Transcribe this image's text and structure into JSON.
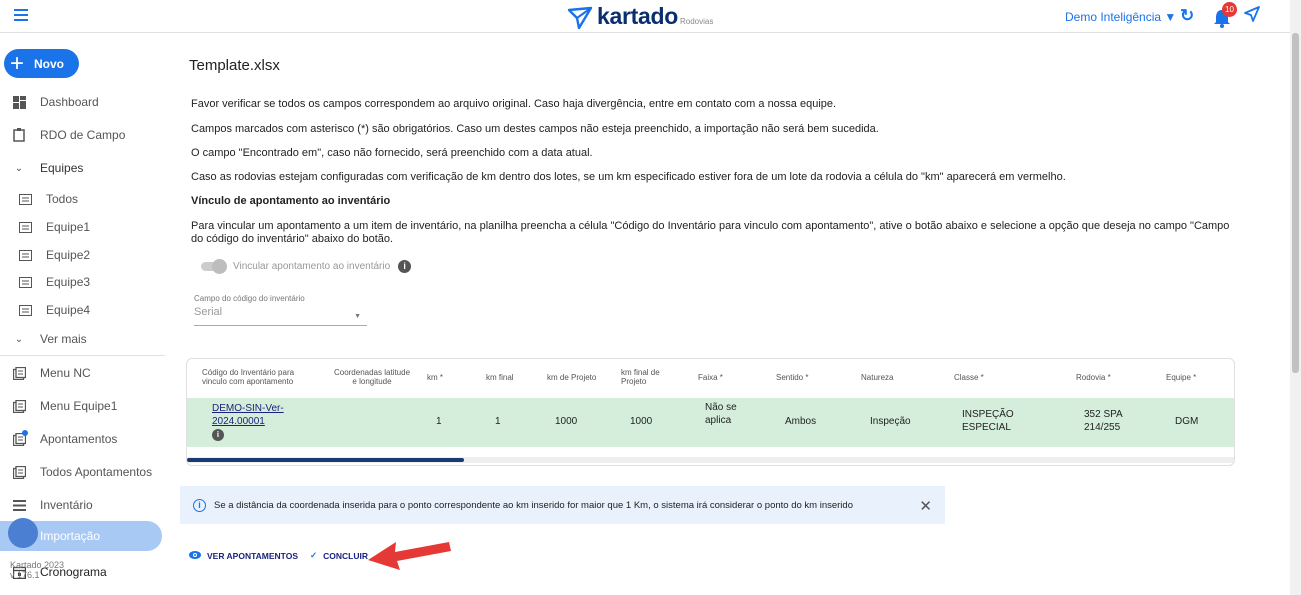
{
  "header": {
    "brand": "kartado",
    "brand_sub": "Rodovias",
    "org_selector": "Demo Inteligência ▼",
    "notifications_count": "10"
  },
  "sidebar": {
    "new_button": "Novo",
    "items": [
      {
        "label": "Dashboard",
        "icon": "dashboard-icon"
      },
      {
        "label": "RDO de Campo",
        "icon": "clipboard-icon"
      },
      {
        "label": "Equipes",
        "icon": "chevron-down-icon"
      },
      {
        "label": "Todos",
        "icon": "list-icon"
      },
      {
        "label": "Equipe1",
        "icon": "list-icon"
      },
      {
        "label": "Equipe2",
        "icon": "list-icon"
      },
      {
        "label": "Equipe3",
        "icon": "list-icon"
      },
      {
        "label": "Equipe4",
        "icon": "list-icon"
      },
      {
        "label": "Ver mais",
        "icon": "chevron-down-icon"
      },
      {
        "label": "Menu NC",
        "icon": "report-icon"
      },
      {
        "label": "Menu Equipe1",
        "icon": "report-icon"
      },
      {
        "label": "Apontamentos",
        "icon": "report-icon"
      },
      {
        "label": "Todos Apontamentos",
        "icon": "report-icon"
      },
      {
        "label": "Inventário",
        "icon": "list-icon"
      },
      {
        "label": "Importação",
        "icon": "import-icon"
      },
      {
        "label": "Cronograma",
        "icon": "calendar-icon"
      }
    ],
    "footer_line1": "Kartado 2023",
    "footer_line2": "v 176.1"
  },
  "main": {
    "title": "Template.xlsx",
    "paragraphs": [
      "Favor verificar se todos os campos correspondem ao arquivo original. Caso haja divergência, entre em contato com a nossa equipe.",
      "Campos marcados com asterisco (*) são obrigatórios. Caso um destes campos não esteja preenchido, a importação não será bem sucedida.",
      "O campo \"Encontrado em\", caso não fornecido, será preenchido com a data atual.",
      "Caso as rodovias estejam configuradas com verificação de km dentro dos lotes, se um km especificado estiver fora de um lote da rodovia a célula do \"km\" aparecerá em vermelho."
    ],
    "section_title": "Vínculo de apontamento ao inventário",
    "section_text": "Para vincular um apontamento a um item de inventário, na planilha preencha a célula \"Código do Inventário para vinculo com apontamento\", ative o botão abaixo e selecione a opção que deseja no campo \"Campo do código do inventário\" abaixo do botão.",
    "toggle_label": "Vincular apontamento ao inventário",
    "select_label": "Campo do código do inventário",
    "select_value": "Serial"
  },
  "table": {
    "headers": {
      "code": "Código do Inventário para vinculo com apontamento",
      "coords": "Coordenadas latitude e longitude",
      "km": "km *",
      "km_final": "km final",
      "km_proj": "km de Projeto",
      "km_final_proj": "km final de Projeto",
      "faixa": "Faixa *",
      "sentido": "Sentido *",
      "natureza": "Natureza",
      "classe": "Classe *",
      "rodovia": "Rodovia *",
      "equipe": "Equipe *"
    },
    "row": {
      "code": "DEMO-SIN-Ver-2024.00001",
      "km": "1",
      "km_final": "1",
      "km_proj": "1000",
      "km_final_proj": "1000",
      "faixa": "Não se aplica",
      "sentido": "Ambos",
      "natureza": "Inspeção",
      "classe": "INSPEÇÃO ESPECIAL",
      "rodovia": "352 SPA 214/255",
      "equipe": "DGM"
    }
  },
  "alert": {
    "text": "Se a distância da coordenada inserida para o ponto correspondente ao km inserido for maior que 1 Km, o sistema irá considerar o ponto do km inserido"
  },
  "actions": {
    "view": "VER APONTAMENTOS",
    "conclude": "CONCLUIR"
  },
  "colors": {
    "primary": "#1a73e8",
    "row_highlight": "#d5eedb",
    "arrow": "#e53935"
  }
}
